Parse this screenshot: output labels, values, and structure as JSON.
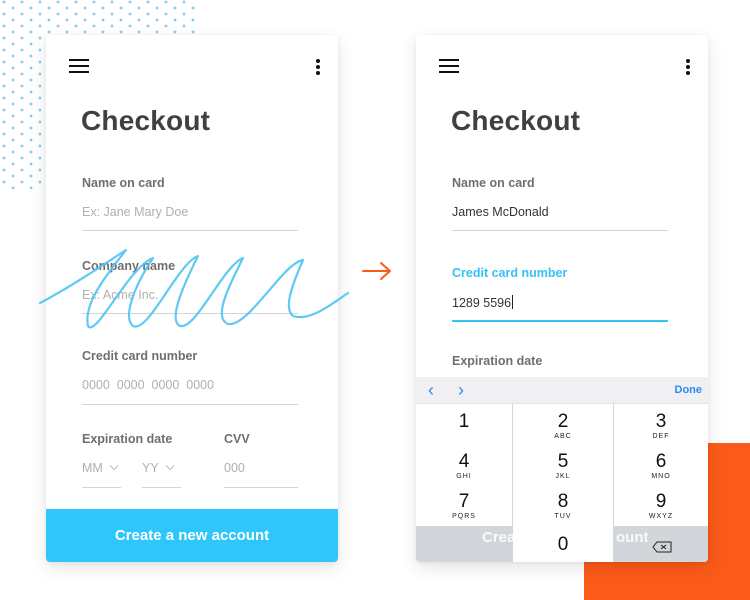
{
  "colors": {
    "accent_blue": "#2ec6fb",
    "active_label": "#33c4f5",
    "arrow_orange": "#fb5a19",
    "keyboard_blue": "#2a8df0"
  },
  "before_screen": {
    "title": "Checkout",
    "fields": {
      "name": {
        "label": "Name on card",
        "placeholder": "Ex: Jane Mary Doe"
      },
      "company": {
        "label": "Company name",
        "placeholder": "Ex: Acme Inc."
      },
      "card_number": {
        "label": "Credit card number",
        "placeholder": "0000  0000  0000  0000"
      },
      "expiration": {
        "label": "Expiration date",
        "month_placeholder": "MM",
        "year_placeholder": "YY"
      },
      "cvv": {
        "label": "CVV",
        "placeholder": "000"
      }
    },
    "cta_label": "Create a new account"
  },
  "after_screen": {
    "title": "Checkout",
    "fields": {
      "name": {
        "label": "Name on card",
        "value": "James McDonald"
      },
      "card_number": {
        "label": "Credit card number",
        "value": "1289 5596"
      },
      "expiration": {
        "label": "Expiration date"
      }
    },
    "cta_ghost_left": "Crea",
    "cta_ghost_right": "ount",
    "keyboard": {
      "prev_icon": "chevron-left",
      "next_icon": "chevron-right",
      "done_label": "Done",
      "keys": [
        {
          "num": "1",
          "letters": ""
        },
        {
          "num": "2",
          "letters": "ABC"
        },
        {
          "num": "3",
          "letters": "DEF"
        },
        {
          "num": "4",
          "letters": "GHI"
        },
        {
          "num": "5",
          "letters": "JKL"
        },
        {
          "num": "6",
          "letters": "MNO"
        },
        {
          "num": "7",
          "letters": "PQRS"
        },
        {
          "num": "8",
          "letters": "TUV"
        },
        {
          "num": "9",
          "letters": "WXYZ"
        },
        {
          "num": "0",
          "letters": ""
        }
      ]
    }
  }
}
